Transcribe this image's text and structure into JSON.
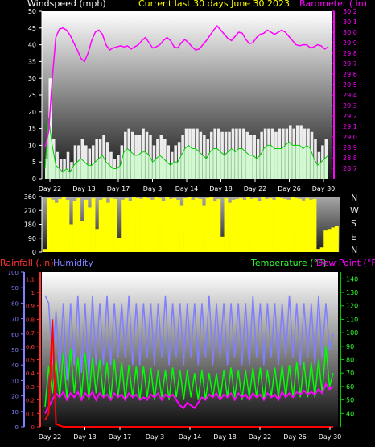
{
  "header": {
    "windspeed_label": "Windspeed (mph)",
    "title": "Current last 30 days June 30 2023",
    "barometer_label": "Barometer (.in)"
  },
  "labels": {
    "rainfall": "Rainfall (.in)",
    "humidity": "Humidity",
    "temperature": "Temperature (°F)",
    "dewpoint": "Dew Point (°F)"
  },
  "directions": [
    "N",
    "W",
    "S",
    "E",
    "N"
  ],
  "colors": {
    "windspeed": "#ffffff",
    "gust_line": "#00cc00",
    "barometer": "#ff00ff",
    "direction": "#ffff00",
    "rainfall": "#ff0000",
    "humidity": "#7f7fff",
    "temperature": "#00ff00",
    "dewpoint": "#ff00ff",
    "title": "#ffff00"
  },
  "chart_data": [
    {
      "type": "area",
      "name": "wind-barometer",
      "x_labels": [
        "Day 22",
        "Day 13",
        "Day 17",
        "Day 3",
        "Day 14",
        "Day 18",
        "Day 22",
        "Day 26",
        "Day 30"
      ],
      "left_axis": {
        "label": "Windspeed (mph)",
        "ylim": [
          0,
          50
        ],
        "ticks": [
          0,
          5,
          10,
          15,
          20,
          25,
          30,
          35,
          40,
          45,
          50
        ]
      },
      "right_axis": {
        "label": "Barometer (.in)",
        "ylim": [
          28.6,
          30.2
        ],
        "ticks": [
          28.7,
          28.8,
          28.9,
          29.0,
          29.1,
          29.2,
          29.3,
          29.4,
          29.5,
          29.6,
          29.7,
          29.8,
          29.9,
          30.0,
          30.1,
          30.2
        ]
      },
      "series": [
        {
          "name": "Barometer",
          "axis": "right",
          "values": [
            28.9,
            29.05,
            29.55,
            29.95,
            30.03,
            30.04,
            30.02,
            29.97,
            29.9,
            29.83,
            29.75,
            29.72,
            29.8,
            29.92,
            30.0,
            30.02,
            29.98,
            29.88,
            29.83,
            29.85,
            29.86,
            29.87,
            29.86,
            29.87,
            29.84,
            29.86,
            29.88,
            29.92,
            29.95,
            29.9,
            29.85,
            29.86,
            29.88,
            29.92,
            29.95,
            29.92,
            29.86,
            29.85,
            29.9,
            29.93,
            29.9,
            29.86,
            29.83,
            29.84,
            29.88,
            29.92,
            29.97,
            30.02,
            30.06,
            30.02,
            29.98,
            29.94,
            29.92,
            29.96,
            30.0,
            29.99,
            29.93,
            29.89,
            29.9,
            29.95,
            29.98,
            29.99,
            30.02,
            30.0,
            29.98,
            30.0,
            30.02,
            30.0,
            29.96,
            29.92,
            29.88,
            29.87,
            29.88,
            29.88,
            29.85,
            29.86,
            29.88,
            29.87,
            29.84,
            29.86
          ]
        },
        {
          "name": "Windspeed",
          "axis": "left",
          "values": [
            3,
            18,
            10,
            4,
            3,
            2,
            3,
            2,
            4,
            5,
            6,
            5,
            4,
            4,
            5,
            6,
            7,
            5,
            4,
            3,
            3,
            4,
            8,
            9,
            8,
            7,
            7,
            8,
            8,
            7,
            5,
            6,
            7,
            6,
            5,
            4,
            5,
            5,
            7,
            9,
            10,
            9,
            9,
            8,
            7,
            6,
            8,
            9,
            9,
            8,
            7,
            8,
            9,
            8,
            9,
            9,
            8,
            7,
            7,
            6,
            7,
            9,
            10,
            10,
            9,
            9,
            9,
            10,
            11,
            10,
            10,
            10,
            9,
            10,
            9,
            6,
            4,
            5,
            6,
            7
          ]
        },
        {
          "name": "Gust",
          "axis": "left",
          "values": [
            6,
            30,
            12,
            8,
            6,
            6,
            8,
            5,
            10,
            10,
            12,
            10,
            9,
            10,
            12,
            12,
            13,
            11,
            8,
            6,
            7,
            10,
            14,
            15,
            14,
            13,
            13,
            15,
            14,
            13,
            10,
            12,
            13,
            12,
            10,
            8,
            10,
            11,
            13,
            15,
            15,
            15,
            15,
            14,
            13,
            12,
            14,
            15,
            15,
            14,
            14,
            14,
            15,
            15,
            15,
            15,
            14,
            13,
            13,
            12,
            14,
            15,
            15,
            15,
            14,
            15,
            15,
            15,
            16,
            15,
            16,
            16,
            15,
            15,
            14,
            12,
            8,
            10,
            12,
            15
          ]
        }
      ]
    },
    {
      "type": "area",
      "name": "wind-direction",
      "left_axis": {
        "ylim": [
          0,
          360
        ],
        "ticks": [
          0,
          90,
          180,
          270,
          360
        ]
      },
      "series": [
        {
          "name": "Direction",
          "values": [
            20,
            350,
            340,
            320,
            345,
            355,
            340,
            180,
            330,
            350,
            200,
            340,
            290,
            350,
            150,
            340,
            350,
            320,
            350,
            345,
            90,
            340,
            350,
            330,
            355,
            350,
            345,
            355,
            350,
            340,
            355,
            350,
            330,
            355,
            345,
            350,
            340,
            300,
            350,
            355,
            340,
            350,
            345,
            300,
            350,
            355,
            330,
            345,
            100,
            350,
            320,
            340,
            345,
            350,
            340,
            355,
            345,
            350,
            330,
            355,
            345,
            350,
            340,
            355,
            350,
            345,
            340,
            355,
            350,
            345,
            335,
            350,
            340,
            345,
            20,
            30,
            140,
            150,
            160,
            170
          ]
        }
      ]
    },
    {
      "type": "line",
      "name": "rain-humidity-temperature",
      "x_labels": [
        "Day 22",
        "Day 13",
        "Day 17",
        "Day 3",
        "Day 14",
        "Day 18",
        "Day 22",
        "Day 26",
        "Day 30"
      ],
      "humidity_axis": {
        "label": "Humidity",
        "ylim": [
          0,
          100
        ],
        "ticks": [
          0,
          10,
          20,
          30,
          40,
          50,
          60,
          70,
          80,
          90,
          100
        ]
      },
      "rain_axis": {
        "label": "Rainfall (.in)",
        "ylim": [
          0,
          1.15
        ],
        "ticks": [
          0,
          0.1,
          0.2,
          0.3,
          0.4,
          0.5,
          0.6,
          0.7,
          0.8,
          0.9,
          1,
          1.1
        ]
      },
      "temp_axis": {
        "label": "Temperature (°F)",
        "ylim": [
          30,
          145
        ],
        "ticks": [
          40,
          50,
          60,
          70,
          80,
          90,
          100,
          110,
          120,
          130,
          140
        ]
      },
      "series": [
        {
          "name": "Humidity",
          "axis": "humidity",
          "values": [
            85,
            80,
            40,
            75,
            35,
            80,
            30,
            80,
            40,
            85,
            35,
            80,
            30,
            85,
            40,
            80,
            40,
            85,
            40,
            80,
            45,
            80,
            45,
            85,
            40,
            80,
            40,
            80,
            45,
            80,
            40,
            80,
            45,
            85,
            40,
            80,
            45,
            80,
            40,
            80,
            45,
            80,
            40,
            80,
            45,
            85,
            40,
            80,
            45,
            80,
            40,
            80,
            45,
            80,
            40,
            80,
            40,
            85,
            45,
            80,
            40,
            80,
            45,
            80,
            40,
            80,
            45,
            85,
            45,
            80,
            40,
            80,
            45,
            80,
            40,
            85,
            45,
            80,
            50,
            60
          ]
        },
        {
          "name": "Temperature",
          "axis": "temp",
          "values": [
            45,
            75,
            55,
            80,
            52,
            85,
            50,
            88,
            55,
            82,
            52,
            85,
            50,
            82,
            55,
            80,
            52,
            78,
            50,
            80,
            52,
            78,
            50,
            76,
            52,
            75,
            50,
            75,
            52,
            74,
            50,
            72,
            52,
            72,
            50,
            74,
            52,
            72,
            50,
            72,
            52,
            70,
            50,
            72,
            50,
            70,
            52,
            70,
            50,
            72,
            52,
            74,
            52,
            72,
            50,
            72,
            52,
            74,
            52,
            74,
            50,
            72,
            52,
            74,
            52,
            76,
            52,
            76,
            52,
            78,
            52,
            78,
            52,
            78,
            52,
            80,
            55,
            90,
            60,
            70
          ]
        },
        {
          "name": "Dew Point",
          "axis": "temp",
          "values": [
            40,
            45,
            50,
            55,
            52,
            56,
            50,
            55,
            52,
            56,
            50,
            55,
            52,
            56,
            50,
            55,
            52,
            54,
            50,
            55,
            52,
            54,
            50,
            55,
            52,
            54,
            50,
            52,
            50,
            54,
            52,
            55,
            50,
            54,
            52,
            54,
            50,
            46,
            44,
            48,
            46,
            44,
            48,
            52,
            50,
            54,
            52,
            55,
            50,
            54,
            52,
            55,
            50,
            55,
            52,
            54,
            50,
            55,
            52,
            54,
            50,
            55,
            52,
            54,
            50,
            56,
            52,
            55,
            52,
            56,
            54,
            57,
            54,
            56,
            54,
            58,
            55,
            62,
            58,
            60
          ]
        },
        {
          "name": "Rainfall",
          "axis": "rain",
          "values": [
            0.05,
            0.1,
            0.8,
            0.02,
            0.01,
            0,
            0,
            0,
            0,
            0,
            0,
            0,
            0,
            0,
            0,
            0,
            0,
            0,
            0,
            0,
            0,
            0,
            0,
            0,
            0,
            0,
            0,
            0,
            0,
            0,
            0,
            0,
            0,
            0,
            0,
            0,
            0,
            0,
            0,
            0,
            0,
            0,
            0,
            0,
            0,
            0,
            0,
            0,
            0,
            0,
            0,
            0,
            0,
            0,
            0,
            0,
            0,
            0,
            0,
            0,
            0,
            0,
            0,
            0,
            0,
            0,
            0,
            0,
            0,
            0,
            0,
            0,
            0,
            0,
            0,
            0,
            0,
            0,
            0,
            0
          ]
        }
      ]
    }
  ]
}
